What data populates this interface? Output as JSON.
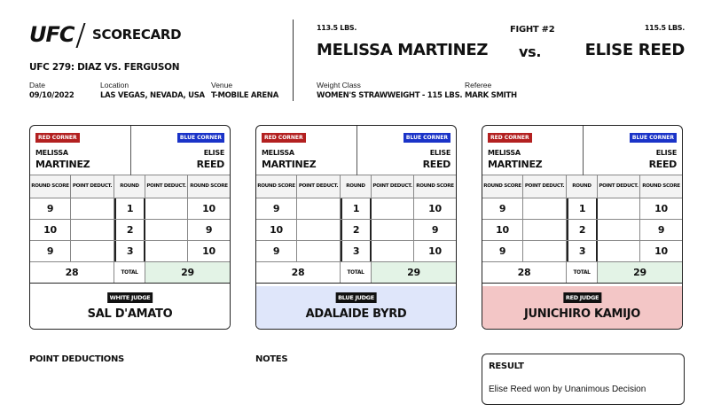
{
  "header": {
    "logo": "UFC",
    "title": "SCORECARD",
    "event": "UFC 279: DIAZ VS. FERGUSON",
    "date_label": "Date",
    "date": "09/10/2022",
    "location_label": "Location",
    "location": "LAS VEGAS, NEVADA, USA",
    "venue_label": "Venue",
    "venue": "T-MOBILE ARENA"
  },
  "fight": {
    "red_weight": "113.5 LBS.",
    "red_fighter": "MELISSA MARTINEZ",
    "number": "FIGHT #2",
    "vs": "vs.",
    "blue_weight": "115.5 LBS.",
    "blue_fighter": "ELISE REED",
    "weight_class_label": "Weight Class",
    "weight_class": "WOMEN'S STRAWWEIGHT - 115 LBS.",
    "referee_label": "Referee",
    "referee": "MARK SMITH"
  },
  "card_labels": {
    "red_corner": "RED CORNER",
    "blue_corner": "BLUE CORNER",
    "red_first": "MELISSA",
    "red_last": "MARTINEZ",
    "blue_first": "ELISE",
    "blue_last": "REED",
    "round_score": "ROUND SCORE",
    "point_deduct": "POINT DEDUCT.",
    "round": "ROUND",
    "total": "TOTAL"
  },
  "cards": [
    {
      "judge_role": "WHITE JUDGE",
      "judge_name": "SAL D'AMATO",
      "judge_bg": "#ffffff",
      "rounds": [
        {
          "red": "9",
          "red_ded": "",
          "round": "1",
          "blue_ded": "",
          "blue": "10"
        },
        {
          "red": "10",
          "red_ded": "",
          "round": "2",
          "blue_ded": "",
          "blue": "9"
        },
        {
          "red": "9",
          "red_ded": "",
          "round": "3",
          "blue_ded": "",
          "blue": "10"
        }
      ],
      "red_total": "28",
      "blue_total": "29"
    },
    {
      "judge_role": "BLUE JUDGE",
      "judge_name": "ADALAIDE BYRD",
      "judge_bg": "#dfe6fa",
      "rounds": [
        {
          "red": "9",
          "red_ded": "",
          "round": "1",
          "blue_ded": "",
          "blue": "10"
        },
        {
          "red": "10",
          "red_ded": "",
          "round": "2",
          "blue_ded": "",
          "blue": "9"
        },
        {
          "red": "9",
          "red_ded": "",
          "round": "3",
          "blue_ded": "",
          "blue": "10"
        }
      ],
      "red_total": "28",
      "blue_total": "29"
    },
    {
      "judge_role": "RED JUDGE",
      "judge_name": "JUNICHIRO KAMIJO",
      "judge_bg": "#f3c6c6",
      "rounds": [
        {
          "red": "9",
          "red_ded": "",
          "round": "1",
          "blue_ded": "",
          "blue": "10"
        },
        {
          "red": "10",
          "red_ded": "",
          "round": "2",
          "blue_ded": "",
          "blue": "9"
        },
        {
          "red": "9",
          "red_ded": "",
          "round": "3",
          "blue_ded": "",
          "blue": "10"
        }
      ],
      "red_total": "28",
      "blue_total": "29"
    }
  ],
  "footer": {
    "point_deductions": "POINT DEDUCTIONS",
    "notes": "NOTES",
    "result_title": "RESULT",
    "result_text": "Elise Reed won by Unanimous Decision"
  },
  "colors": {
    "red_corner": "#b32020",
    "blue_corner": "#1a33c8",
    "total_highlight": "#e3f3e6"
  }
}
